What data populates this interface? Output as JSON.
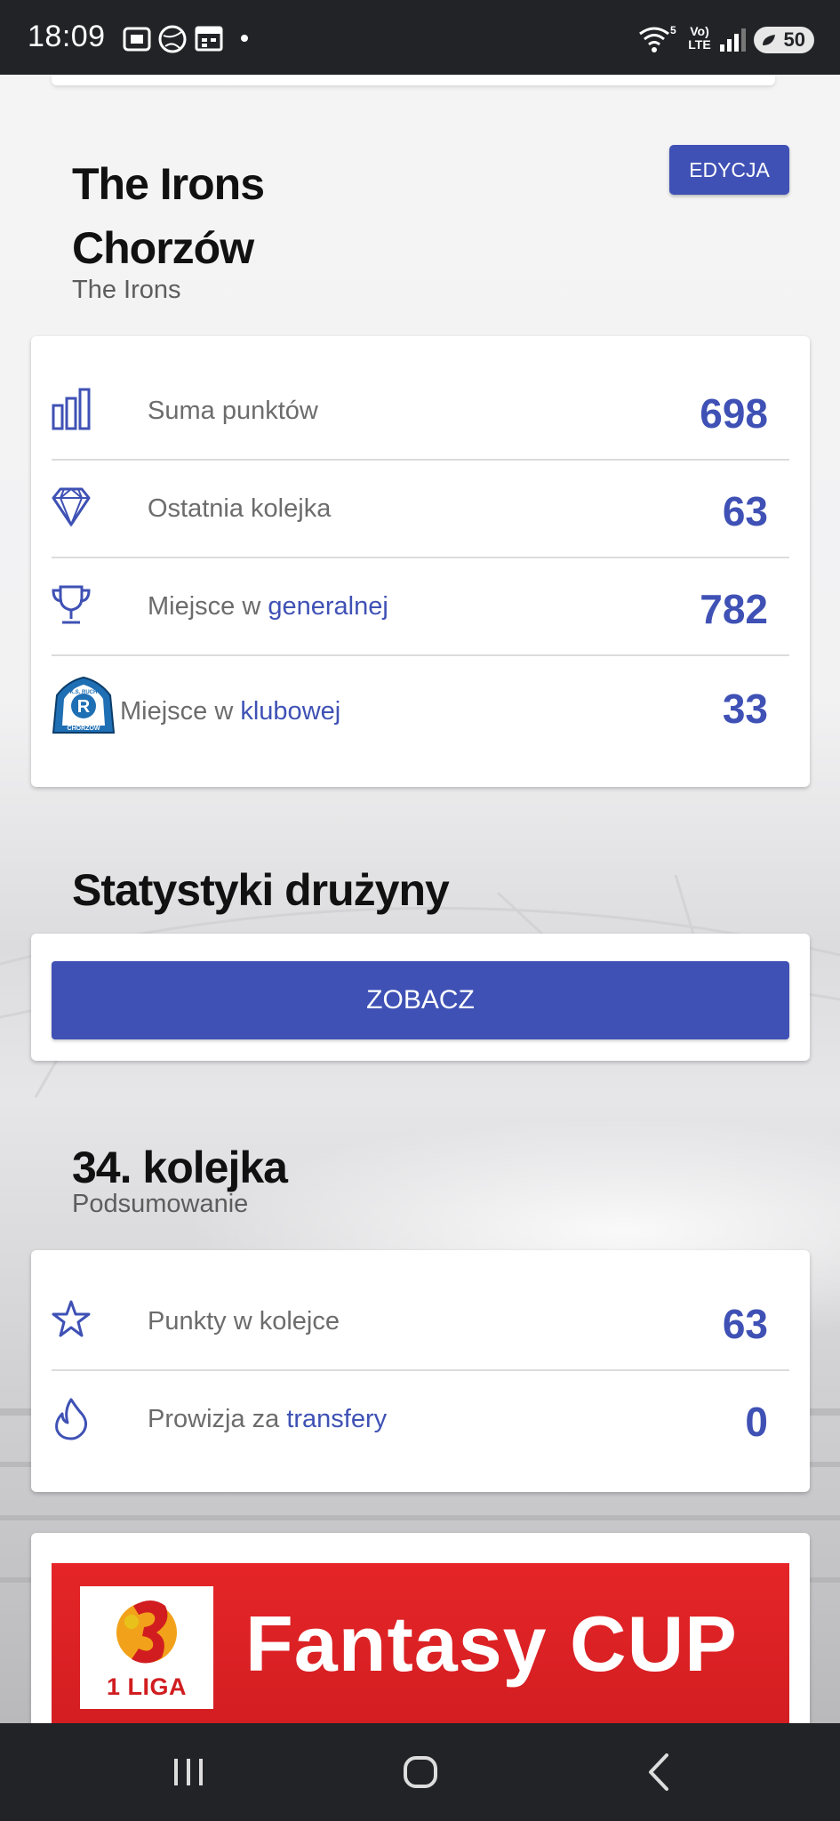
{
  "status_bar": {
    "time": "18:09",
    "battery": "50",
    "network": "Vo) LTE",
    "wifi_badge": "5"
  },
  "team": {
    "name_line1": "The Irons",
    "name_line2": "Chorzów",
    "short_name": "The Irons",
    "edit_label": "EDYCJA"
  },
  "summary": [
    {
      "icon": "bar-chart-icon",
      "label": "Suma punktów",
      "link": "",
      "value": "698"
    },
    {
      "icon": "diamond-icon",
      "label": "Ostatnia kolejka ",
      "link": "",
      "value": "63"
    },
    {
      "icon": "trophy-icon",
      "label": "Miejsce w ",
      "link": "generalnej",
      "value": "782"
    },
    {
      "icon": "club-crest-icon",
      "label": "Miejsce w ",
      "link": "klubowej",
      "value": "33"
    }
  ],
  "club_crest_text": {
    "top": "K.S. RUCH",
    "bottom": "CHORZÓW",
    "letter": "R"
  },
  "team_stats": {
    "title": "Statystyki drużyny",
    "button_label": "ZOBACZ"
  },
  "round": {
    "title": "34. kolejka",
    "subtitle": "Podsumowanie",
    "rows": [
      {
        "icon": "star-icon",
        "label": "Punkty w kolejce",
        "link": "",
        "value": "63"
      },
      {
        "icon": "flame-icon",
        "label": "Prowizja za ",
        "link": "transfery",
        "value": "0"
      }
    ]
  },
  "banner": {
    "text": "Fantasy CUP",
    "logo_text": "1 LIGA"
  },
  "colors": {
    "accent": "#3f51b5",
    "status_bar": "#222327",
    "banner_red": "#d11d20"
  }
}
